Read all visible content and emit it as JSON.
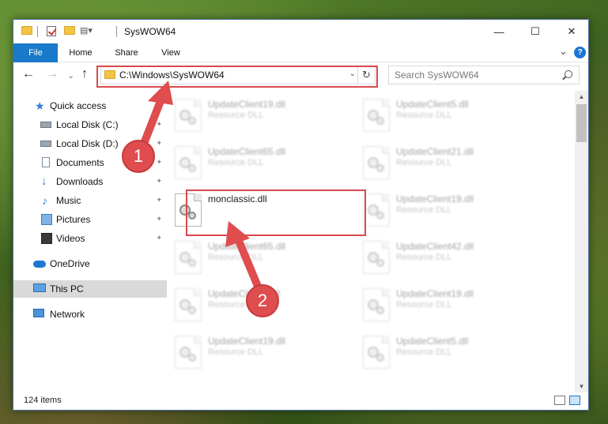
{
  "window": {
    "title": "SysWOW64",
    "controls": {
      "minimize": "—",
      "maximize": "☐",
      "close": "✕"
    }
  },
  "ribbon": {
    "tabs": [
      "File",
      "Home",
      "Share",
      "View"
    ],
    "expand_glyph": "⌄",
    "help": "?"
  },
  "nav": {
    "back": "←",
    "forward": "→",
    "recent": "⌄",
    "up": "↑",
    "address": "C:\\Windows\\SysWOW64",
    "address_dropdown": "⌄",
    "refresh": "↻",
    "search_placeholder": "Search SysWOW64"
  },
  "sidebar": {
    "items": [
      {
        "label": "Quick access",
        "icon": "star-icon"
      },
      {
        "label": "Local Disk (C:)",
        "icon": "disk-icon",
        "pinned": true
      },
      {
        "label": "Local Disk (D:)",
        "icon": "disk-icon",
        "pinned": true
      },
      {
        "label": "Documents",
        "icon": "documents-icon",
        "pinned": true
      },
      {
        "label": "Downloads",
        "icon": "download-icon",
        "pinned": true
      },
      {
        "label": "Music",
        "icon": "music-icon",
        "pinned": true
      },
      {
        "label": "Pictures",
        "icon": "pictures-icon",
        "pinned": true
      },
      {
        "label": "Videos",
        "icon": "videos-icon",
        "pinned": true
      },
      {
        "label": "OneDrive",
        "icon": "cloud-icon"
      },
      {
        "label": "This PC",
        "icon": "computer-icon",
        "selected": true
      },
      {
        "label": "Network",
        "icon": "network-icon"
      }
    ],
    "pin_glyph": "📌"
  },
  "files": [
    {
      "name": "UpdateClient19.dll",
      "type": "Resource DLL",
      "blurred": true
    },
    {
      "name": "UpdateClient5.dll",
      "type": "Resource DLL",
      "blurred": true
    },
    {
      "name": "UpdateClient65.dll",
      "type": "Resource DLL",
      "blurred": true
    },
    {
      "name": "UpdateClient21.dll",
      "type": "Resource DLL",
      "blurred": true
    },
    {
      "name": "monclassic.dll",
      "type": "",
      "blurred": false
    },
    {
      "name": "UpdateClient19.dll",
      "type": "Resource DLL",
      "blurred": true
    },
    {
      "name": "UpdateClient65.dll",
      "type": "Resource DLL",
      "blurred": true
    },
    {
      "name": "UpdateClient42.dll",
      "type": "Resource DLL",
      "blurred": true
    },
    {
      "name": "UpdateClient5.dll",
      "type": "Resource DLL",
      "blurred": true
    },
    {
      "name": "UpdateClient19.dll",
      "type": "Resource DLL",
      "blurred": true
    },
    {
      "name": "UpdateClient19.dll",
      "type": "Resource DLL",
      "blurred": true
    },
    {
      "name": "UpdateClient5.dll",
      "type": "Resource DLL",
      "blurred": true
    }
  ],
  "status": {
    "item_count": "124 items"
  },
  "callouts": {
    "step1": "1",
    "step2": "2"
  },
  "colors": {
    "accent": "#1979ca",
    "highlight": "#d9494c",
    "callout": "#df4d4f"
  }
}
